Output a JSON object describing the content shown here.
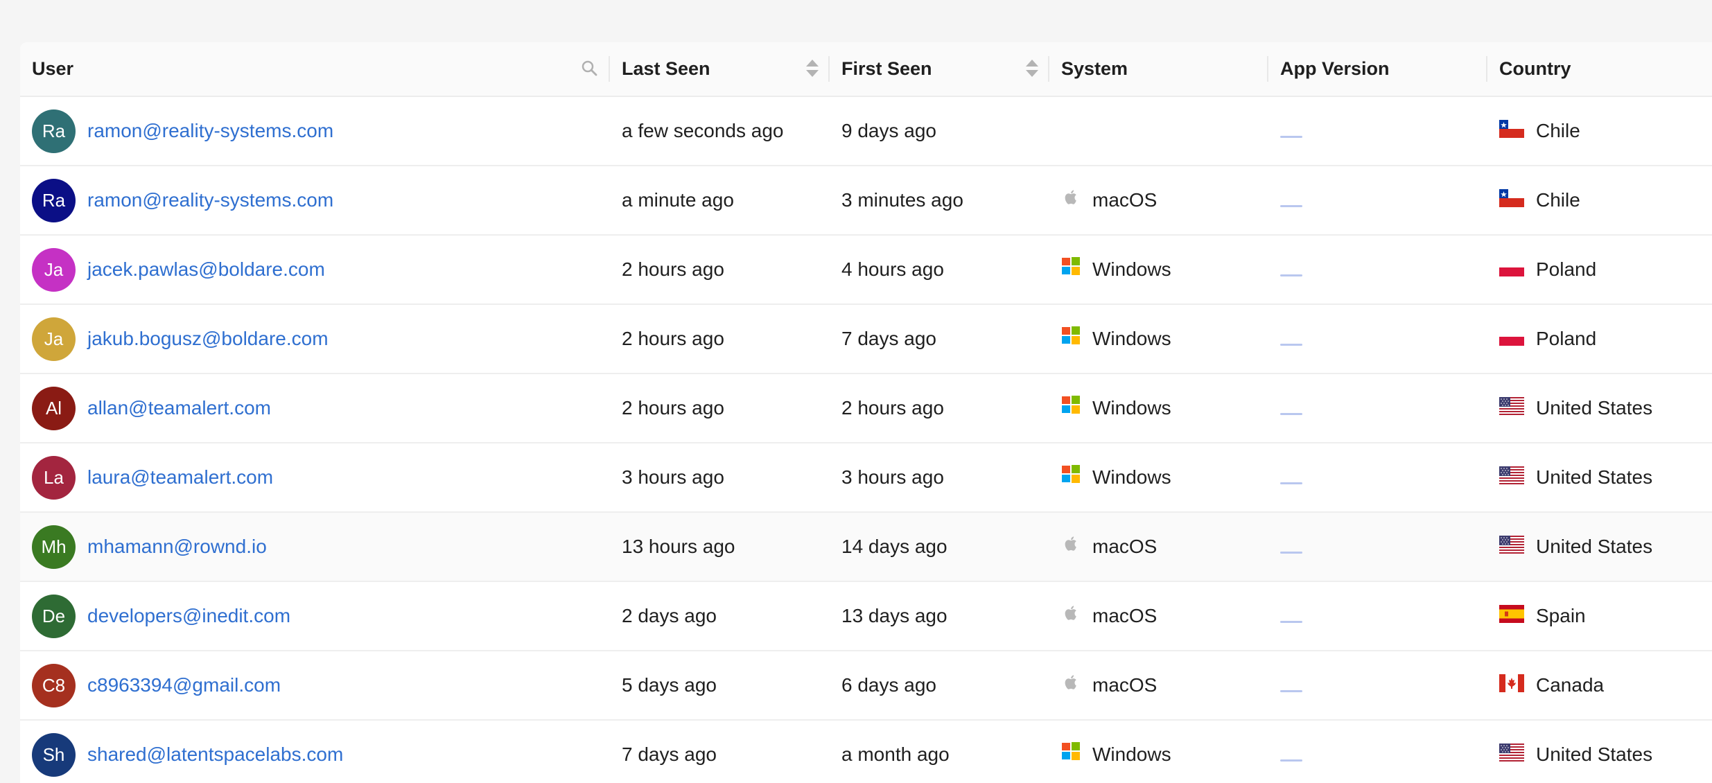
{
  "columns": [
    {
      "label": "User"
    },
    {
      "label": "Last Seen"
    },
    {
      "label": "First Seen"
    },
    {
      "label": "System"
    },
    {
      "label": "App Version"
    },
    {
      "label": "Country"
    }
  ],
  "rows": [
    {
      "initials": "Ra",
      "avatar_color": "#2f7075",
      "email": "ramon@reality-systems.com",
      "last_seen": "a few seconds ago",
      "first_seen": "9 days ago",
      "system": "",
      "os": "none",
      "country": "Chile",
      "flag": "chile"
    },
    {
      "initials": "Ra",
      "avatar_color": "#0b0f86",
      "email": "ramon@reality-systems.com",
      "last_seen": "a minute ago",
      "first_seen": "3 minutes ago",
      "system": "macOS",
      "os": "apple-icon",
      "country": "Chile",
      "flag": "chile"
    },
    {
      "initials": "Ja",
      "avatar_color": "#c531c4",
      "email": "jacek.pawlas@boldare.com",
      "last_seen": "2 hours ago",
      "first_seen": "4 hours ago",
      "system": "Windows",
      "os": "windows-icon",
      "country": "Poland",
      "flag": "poland"
    },
    {
      "initials": "Ja",
      "avatar_color": "#cfa63a",
      "email": "jakub.bogusz@boldare.com",
      "last_seen": "2 hours ago",
      "first_seen": "7 days ago",
      "system": "Windows",
      "os": "windows-icon",
      "country": "Poland",
      "flag": "poland"
    },
    {
      "initials": "Al",
      "avatar_color": "#8a1b14",
      "email": "allan@teamalert.com",
      "last_seen": "2 hours ago",
      "first_seen": "2 hours ago",
      "system": "Windows",
      "os": "windows-icon",
      "country": "United States",
      "flag": "usa"
    },
    {
      "initials": "La",
      "avatar_color": "#a3253f",
      "email": "laura@teamalert.com",
      "last_seen": "3 hours ago",
      "first_seen": "3 hours ago",
      "system": "Windows",
      "os": "windows-icon",
      "country": "United States",
      "flag": "usa"
    },
    {
      "initials": "Mh",
      "avatar_color": "#3a7a22",
      "email": "mhamann@rownd.io",
      "last_seen": "13 hours ago",
      "first_seen": "14 days ago",
      "system": "macOS",
      "os": "apple-icon",
      "country": "United States",
      "flag": "usa"
    },
    {
      "initials": "De",
      "avatar_color": "#2e6b34",
      "email": "developers@inedit.com",
      "last_seen": "2 days ago",
      "first_seen": "13 days ago",
      "system": "macOS",
      "os": "apple-icon",
      "country": "Spain",
      "flag": "spain"
    },
    {
      "initials": "C8",
      "avatar_color": "#a5301f",
      "email": "c8963394@gmail.com",
      "last_seen": "5 days ago",
      "first_seen": "6 days ago",
      "system": "macOS",
      "os": "apple-icon",
      "country": "Canada",
      "flag": "canada"
    },
    {
      "initials": "Sh",
      "avatar_color": "#173a7a",
      "email": "shared@latentspacelabs.com",
      "last_seen": "7 days ago",
      "first_seen": "a month ago",
      "system": "Windows",
      "os": "windows-icon",
      "country": "United States",
      "flag": "usa"
    }
  ],
  "colors": {
    "link": "#2f6fd0",
    "header_bg": "#fafafa",
    "page_bg": "#f5f5f5",
    "empty_dash": "#b9c7ef"
  }
}
